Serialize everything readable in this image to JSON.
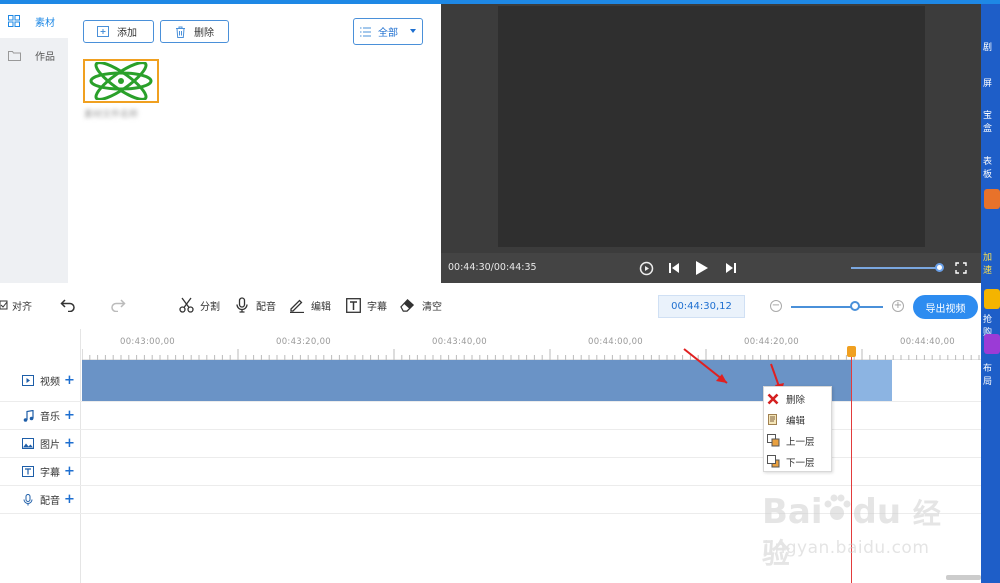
{
  "rail": {
    "items": [
      {
        "label": "素材",
        "icon": "grid-icon",
        "active": true
      },
      {
        "label": "作品",
        "icon": "folder-icon",
        "active": false
      }
    ]
  },
  "material": {
    "add_label": "添加",
    "delete_label": "删除",
    "filter_label": "全部",
    "thumb_caption": "素材文件名称"
  },
  "player": {
    "time": "00:44:30/00:44:35"
  },
  "toolbar": {
    "align_label": "对齐",
    "split_label": "分割",
    "dub_label": "配音",
    "edit_label": "编辑",
    "subtitle_label": "字幕",
    "clear_label": "清空",
    "timecode": "00:44:30,12",
    "export_label": "导出视频"
  },
  "timeline": {
    "ruler_labels": [
      "00:43:00,00",
      "00:43:20,00",
      "00:43:40,00",
      "00:44:00,00",
      "00:44:20,00",
      "00:44:40,00"
    ],
    "tracks": [
      {
        "label": "视频",
        "icon": "video-icon"
      },
      {
        "label": "音乐",
        "icon": "music-icon"
      },
      {
        "label": "图片",
        "icon": "image-icon"
      },
      {
        "label": "字幕",
        "icon": "text-icon"
      },
      {
        "label": "配音",
        "icon": "mic-icon"
      }
    ]
  },
  "context_menu": {
    "items": [
      {
        "label": "删除",
        "icon": "delete-x-icon"
      },
      {
        "label": "编辑",
        "icon": "edit-icon"
      },
      {
        "label": "上一层",
        "icon": "layer-up-icon"
      },
      {
        "label": "下一层",
        "icon": "layer-down-icon"
      }
    ]
  },
  "sidebar_right": {
    "snippets": [
      "剧",
      "屏",
      "宝盒",
      "表板",
      "加速",
      "抢购",
      "布局"
    ]
  },
  "watermark": {
    "brand": "Bai",
    "brand2": "du",
    "cn": "经验",
    "url": "jingyan.baidu.com"
  },
  "colors": {
    "accent": "#2d8cf0",
    "clip": "#6a93c6",
    "playhead": "#e23b3b",
    "handle": "#f0a020"
  }
}
